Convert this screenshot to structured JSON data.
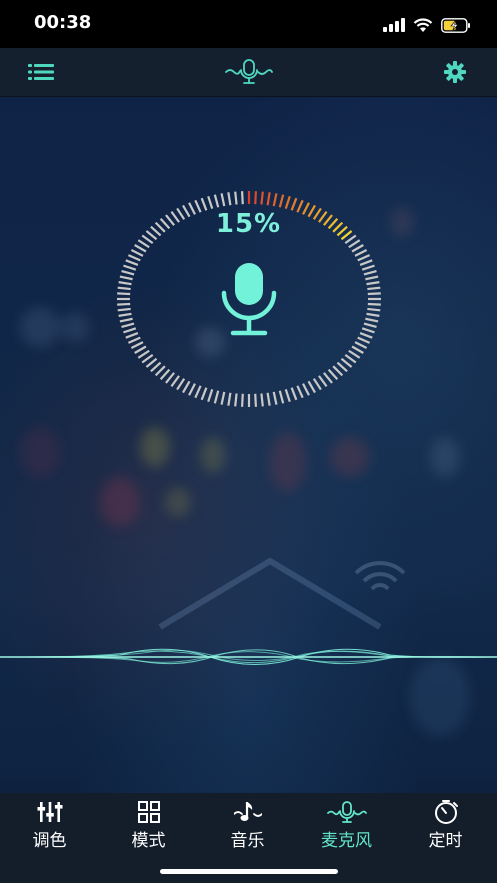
{
  "status": {
    "time": "00:38"
  },
  "mic": {
    "percent_text": "15%",
    "level": 0.15
  },
  "tabs": [
    {
      "label": "调色",
      "icon": "equalizer-icon",
      "active": false
    },
    {
      "label": "模式",
      "icon": "grid-icon",
      "active": false
    },
    {
      "label": "音乐",
      "icon": "music-note-icon",
      "active": false
    },
    {
      "label": "麦克风",
      "icon": "microphone-icon",
      "active": true
    },
    {
      "label": "定时",
      "icon": "timer-icon",
      "active": false
    }
  ],
  "colors": {
    "accent": "#62e6c9",
    "gauge_idle": "#c8c8c8",
    "gauge_red": "#d8402a",
    "gauge_yellow": "#f2d530"
  }
}
